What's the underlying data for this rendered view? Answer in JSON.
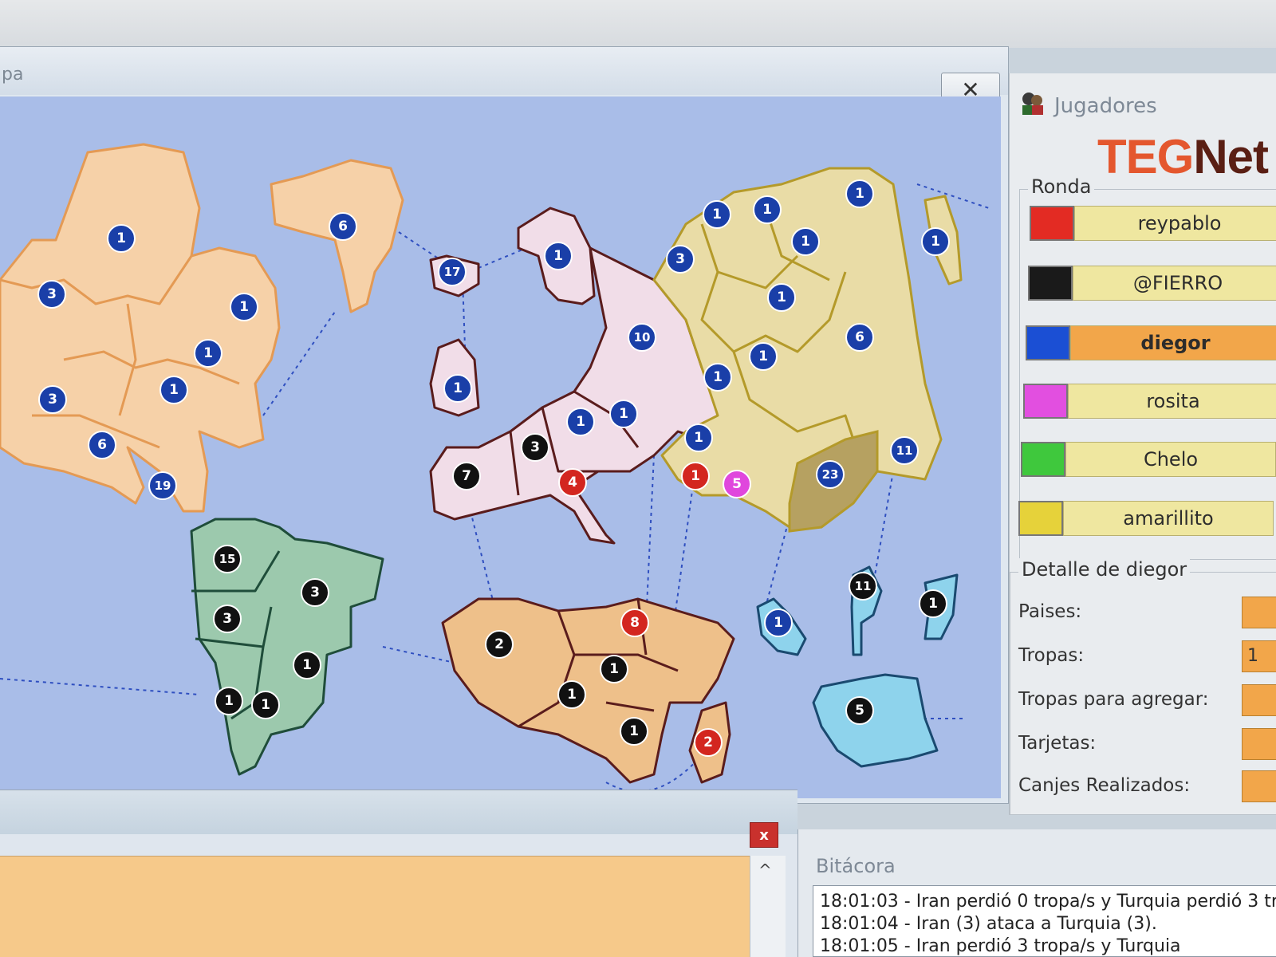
{
  "map_window": {
    "title": "pa",
    "close_glyph": "✕"
  },
  "players_panel": {
    "title": "Jugadores",
    "icon": "players-icon",
    "brand": {
      "part1": "TEG",
      "part2": "Net"
    },
    "ronda": {
      "label": "Ronda",
      "players": [
        {
          "name": "reypablo",
          "color": "#e32b23"
        },
        {
          "name": "@FIERRO",
          "color": "#1a1a1a"
        },
        {
          "name": "diegor",
          "color": "#1b4fd4"
        },
        {
          "name": "rosita",
          "color": "#e24fe0"
        },
        {
          "name": "Chelo",
          "color": "#3fc83d"
        },
        {
          "name": "amarillito",
          "color": "#e6d23a"
        }
      ]
    },
    "detalle": {
      "label": "Detalle de diegor",
      "fields": [
        {
          "label": "Paises:",
          "value": ""
        },
        {
          "label": "Tropas:",
          "value": "1"
        },
        {
          "label": "Tropas para agregar:",
          "value": ""
        },
        {
          "label": "Tarjetas:",
          "value": ""
        },
        {
          "label": "Canjes Realizados:",
          "value": ""
        }
      ]
    }
  },
  "chat_window": {
    "close_glyph": "x",
    "scroll_up_glyph": "^"
  },
  "log_window": {
    "title": "Bitácora",
    "lines": [
      "18:01:03 - Iran perdió 0 tropa/s y Turquia perdió 3 trop",
      "18:01:04 - Iran (3) ataca a Turquia (3).",
      "18:01:05 - Iran perdió 3 tropa/s y Turquia"
    ]
  },
  "map": {
    "colors": {
      "ocean": "#a9bde8",
      "north_america": "#f6d1a8",
      "south_america": "#9cc9ad",
      "europe": "#f1dde8",
      "asia": "#e9dca6",
      "africa": "#eec08a",
      "oceania": "#8ed3ec",
      "border_na": "#e49a54",
      "border_eu": "#5a1c1c",
      "border_asia": "#b49a2a",
      "border_sa": "#1f4d3a",
      "border_oc": "#1a4a70"
    },
    "badges": [
      {
        "label": "1",
        "owner": "blue"
      },
      {
        "label": "3",
        "owner": "blue"
      },
      {
        "label": "1",
        "owner": "blue"
      },
      {
        "label": "1",
        "owner": "blue"
      },
      {
        "label": "3",
        "owner": "blue"
      },
      {
        "label": "1",
        "owner": "blue"
      },
      {
        "label": "6",
        "owner": "blue"
      },
      {
        "label": "19",
        "owner": "blue"
      },
      {
        "label": "6",
        "owner": "blue"
      },
      {
        "label": "17",
        "owner": "blue"
      },
      {
        "label": "1",
        "owner": "blue"
      },
      {
        "label": "1",
        "owner": "blue"
      },
      {
        "label": "10",
        "owner": "blue"
      },
      {
        "label": "1",
        "owner": "blue"
      },
      {
        "label": "1",
        "owner": "blue"
      },
      {
        "label": "3",
        "owner": "black"
      },
      {
        "label": "7",
        "owner": "black"
      },
      {
        "label": "4",
        "owner": "red"
      },
      {
        "label": "1",
        "owner": "blue"
      },
      {
        "label": "1",
        "owner": "blue"
      },
      {
        "label": "1",
        "owner": "blue"
      },
      {
        "label": "3",
        "owner": "blue"
      },
      {
        "label": "1",
        "owner": "blue"
      },
      {
        "label": "1",
        "owner": "blue"
      },
      {
        "label": "1",
        "owner": "blue"
      },
      {
        "label": "6",
        "owner": "blue"
      },
      {
        "label": "1",
        "owner": "blue"
      },
      {
        "label": "1",
        "owner": "blue"
      },
      {
        "label": "1",
        "owner": "blue"
      },
      {
        "label": "1",
        "owner": "red"
      },
      {
        "label": "5",
        "owner": "magenta"
      },
      {
        "label": "23",
        "owner": "blue"
      },
      {
        "label": "11",
        "owner": "blue"
      },
      {
        "label": "15",
        "owner": "black"
      },
      {
        "label": "3",
        "owner": "black"
      },
      {
        "label": "3",
        "owner": "black"
      },
      {
        "label": "1",
        "owner": "black"
      },
      {
        "label": "1",
        "owner": "black"
      },
      {
        "label": "1",
        "owner": "black"
      },
      {
        "label": "2",
        "owner": "black"
      },
      {
        "label": "8",
        "owner": "red"
      },
      {
        "label": "1",
        "owner": "black"
      },
      {
        "label": "1",
        "owner": "black"
      },
      {
        "label": "1",
        "owner": "black"
      },
      {
        "label": "2",
        "owner": "red"
      },
      {
        "label": "1",
        "owner": "blue"
      },
      {
        "label": "11",
        "owner": "black"
      },
      {
        "label": "1",
        "owner": "black"
      },
      {
        "label": "5",
        "owner": "black"
      }
    ],
    "owner_colors": {
      "blue": "#1a3fa8",
      "black": "#111111",
      "red": "#d3261f",
      "magenta": "#e047dd"
    }
  }
}
